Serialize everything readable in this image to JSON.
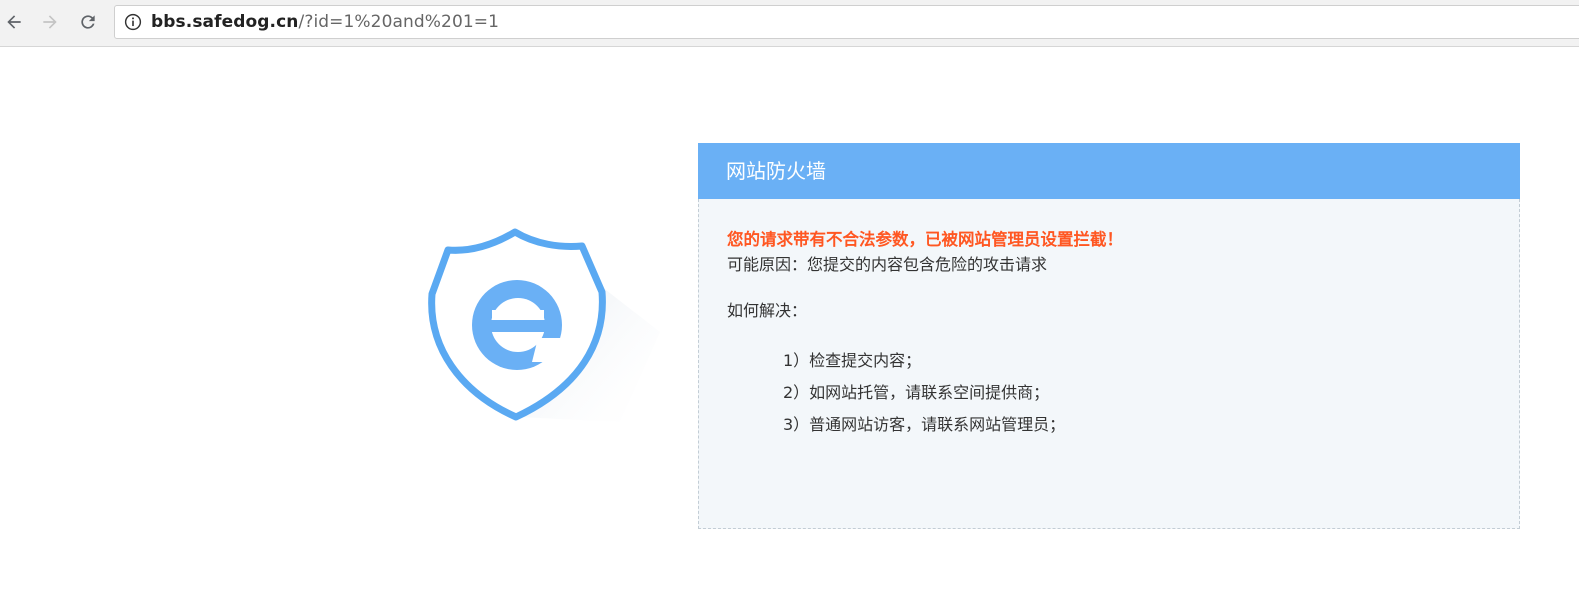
{
  "browser": {
    "back_icon": "arrow-left-icon",
    "forward_icon": "arrow-right-icon",
    "reload_icon": "reload-icon",
    "info_icon": "info-icon",
    "url_host": "bbs.safedog.cn",
    "url_path": "/?id=1%20and%201=1"
  },
  "colors": {
    "header_blue": "#6ab0f5",
    "warning_orange": "#ff5722",
    "panel_bg": "#f3f7fa"
  },
  "page": {
    "title": "网站防火墙",
    "warning": "您的请求带有不合法参数，已被网站管理员设置拦截！",
    "reason": "可能原因：您提交的内容包含危险的攻击请求",
    "solve_title": "如何解决：",
    "solutions": [
      "1）检查提交内容；",
      "2）如网站托管，请联系空间提供商；",
      "3）普通网站访客，请联系网站管理员；"
    ]
  }
}
